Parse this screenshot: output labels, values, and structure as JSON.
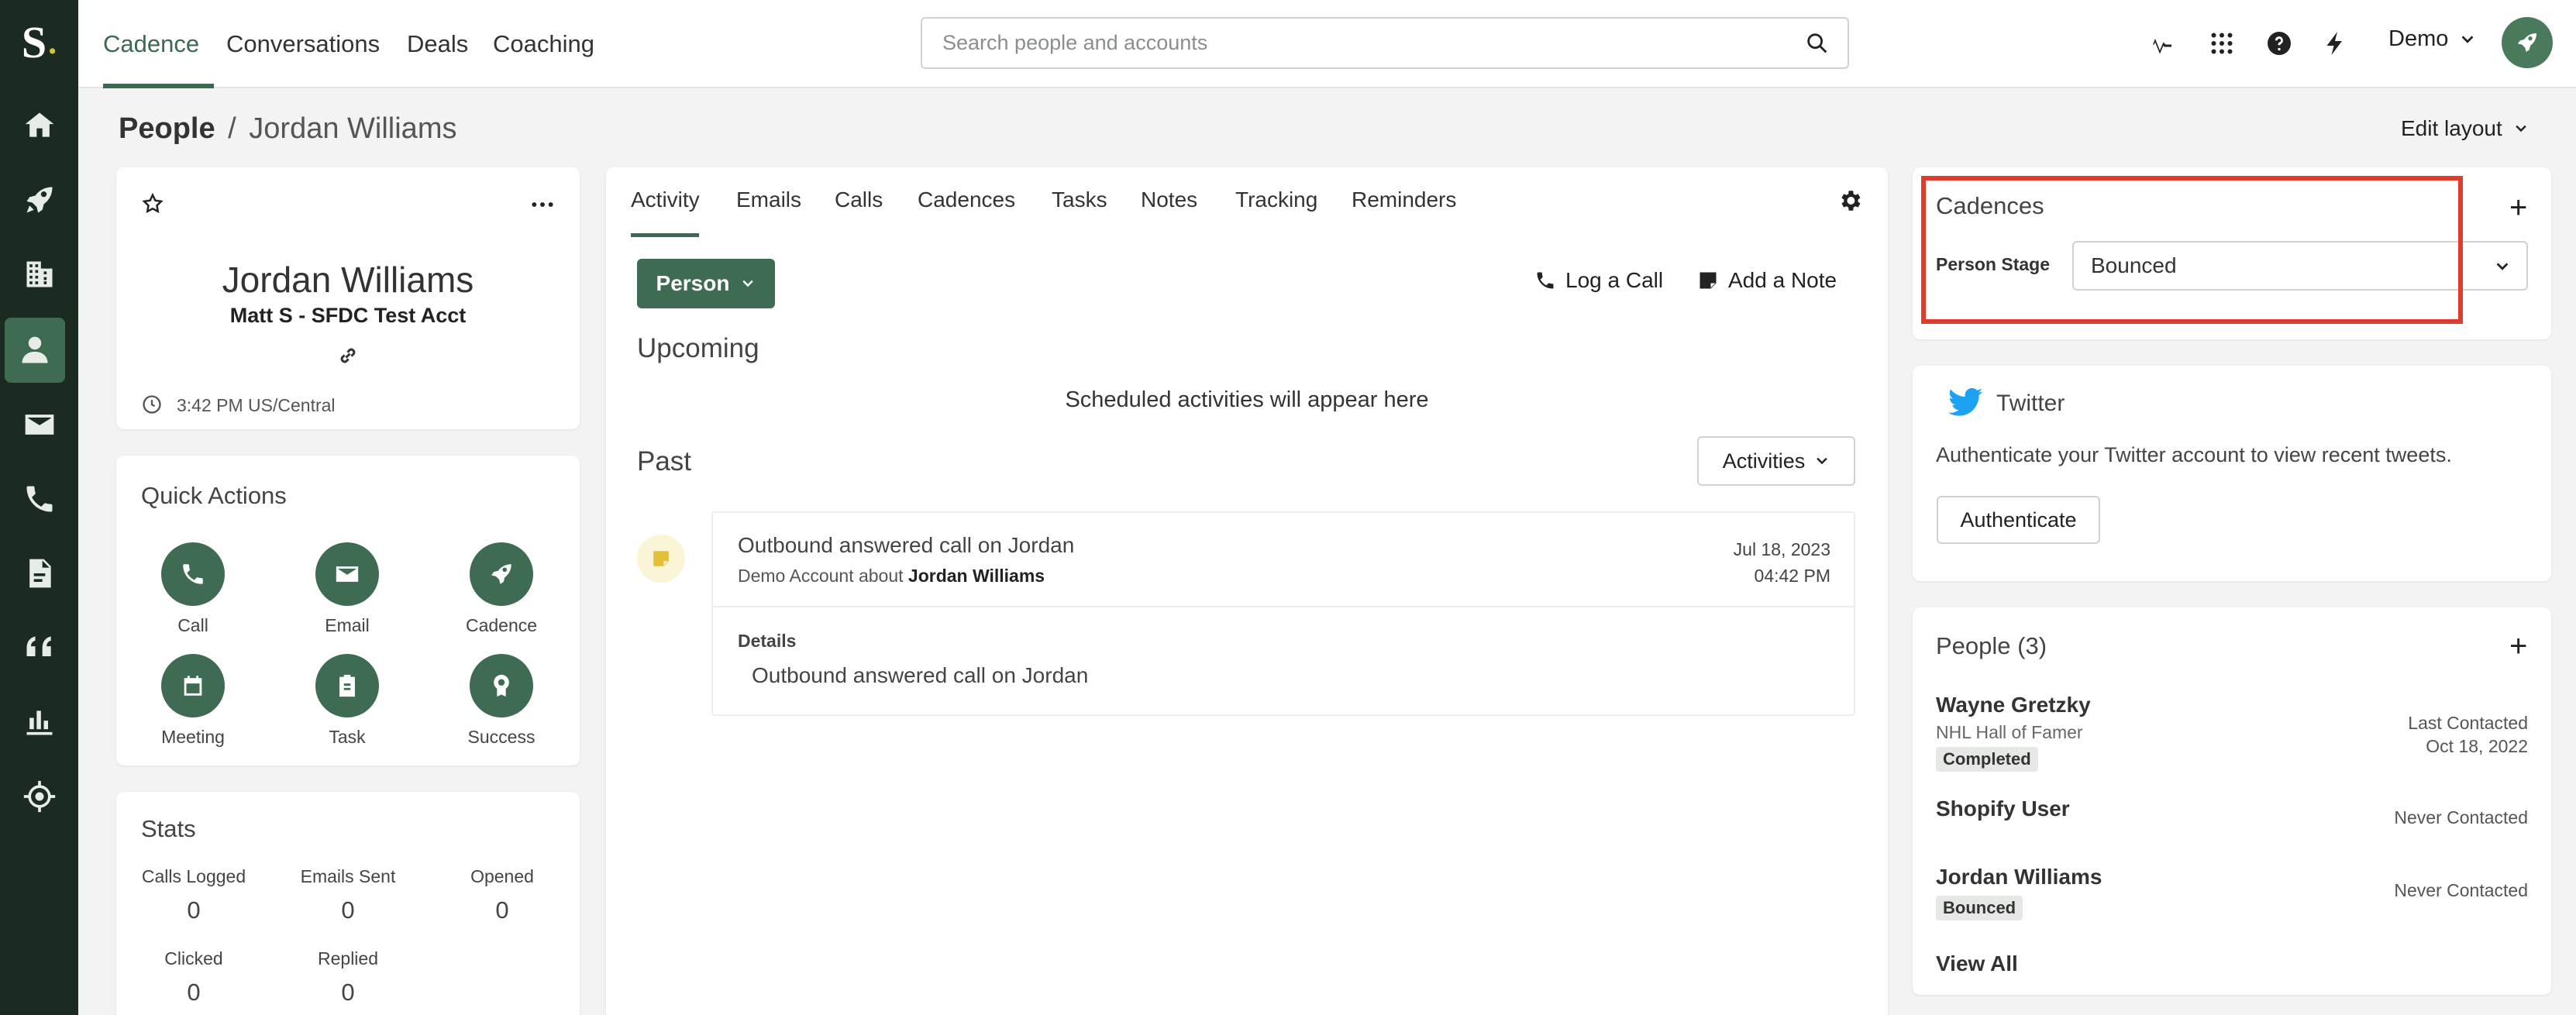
{
  "app": {
    "logo_letter": "S",
    "top_nav": [
      "Cadence",
      "Conversations",
      "Deals",
      "Coaching"
    ],
    "search_placeholder": "Search people and accounts",
    "user_label": "Demo"
  },
  "rail_icons": [
    "home-icon",
    "rocket-icon",
    "building-icon",
    "person-icon",
    "mail-icon",
    "phone-icon",
    "document-icon",
    "quote-icon",
    "bar-chart-icon",
    "target-icon"
  ],
  "breadcrumb": {
    "root": "People",
    "separator": "/",
    "current": "Jordan Williams"
  },
  "edit_layout_label": "Edit layout",
  "profile": {
    "name": "Jordan Williams",
    "account": "Matt S - SFDC Test Acct",
    "local_time": "3:42 PM US/Central"
  },
  "quick_actions": {
    "title": "Quick Actions",
    "items": [
      {
        "label": "Call",
        "icon": "phone-icon"
      },
      {
        "label": "Email",
        "icon": "mail-icon"
      },
      {
        "label": "Cadence",
        "icon": "rocket-icon"
      },
      {
        "label": "Meeting",
        "icon": "calendar-icon"
      },
      {
        "label": "Task",
        "icon": "clipboard-icon"
      },
      {
        "label": "Success",
        "icon": "award-icon"
      }
    ]
  },
  "stats": {
    "title": "Stats",
    "items": [
      {
        "label": "Calls Logged",
        "value": "0"
      },
      {
        "label": "Emails Sent",
        "value": "0"
      },
      {
        "label": "Opened",
        "value": "0"
      },
      {
        "label": "Clicked",
        "value": "0"
      },
      {
        "label": "Replied",
        "value": "0"
      }
    ]
  },
  "activity": {
    "tabs": [
      "Activity",
      "Emails",
      "Calls",
      "Cadences",
      "Tasks",
      "Notes",
      "Tracking",
      "Reminders"
    ],
    "person_button": "Person",
    "log_call": "Log a Call",
    "add_note": "Add a Note",
    "upcoming_title": "Upcoming",
    "upcoming_empty": "Scheduled activities will appear here",
    "past_title": "Past",
    "filter_button": "Activities",
    "items": [
      {
        "title": "Outbound answered call on Jordan",
        "subtitle_prefix": "Demo Account about",
        "subtitle_person": "Jordan Williams",
        "date": "Jul 18, 2023",
        "time": "04:42 PM",
        "details_label": "Details",
        "details_text": "Outbound answered call on Jordan"
      }
    ]
  },
  "cadences": {
    "title": "Cadences",
    "stage_label": "Person Stage",
    "stage_value": "Bounced",
    "highlight_color": "#e03c2d"
  },
  "twitter": {
    "title": "Twitter",
    "description": "Authenticate your Twitter account to view recent tweets.",
    "button": "Authenticate",
    "brand_color": "#1da1f2"
  },
  "people": {
    "title": "People (3)",
    "items": [
      {
        "name": "Wayne Gretzky",
        "subtitle": "NHL Hall of Famer",
        "badge": "Completed",
        "contact_label": "Last Contacted",
        "contact_date": "Oct 18, 2022"
      },
      {
        "name": "Shopify User",
        "subtitle": "",
        "badge": "",
        "contact_label": "Never Contacted",
        "contact_date": ""
      },
      {
        "name": "Jordan Williams",
        "subtitle": "",
        "badge": "Bounced",
        "contact_label": "Never Contacted",
        "contact_date": ""
      }
    ],
    "view_all": "View All"
  },
  "colors": {
    "rail_bg": "#1b2b22",
    "brand_green": "#3f6b52",
    "accent_text": "#3b6a50"
  }
}
